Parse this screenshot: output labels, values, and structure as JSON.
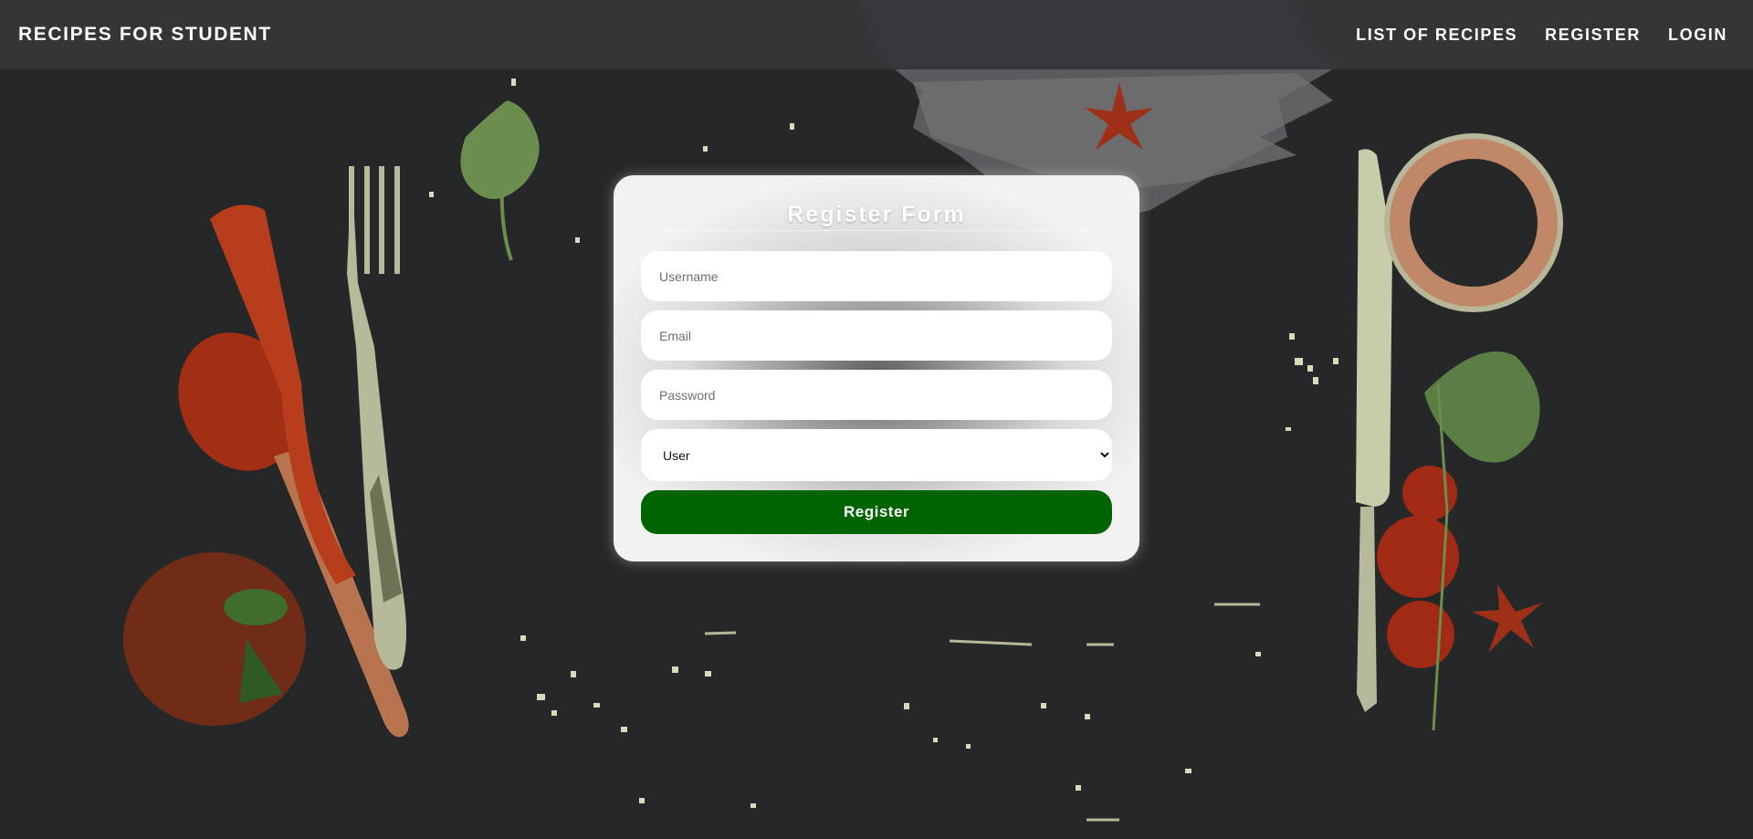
{
  "nav": {
    "brand": "RECIPES FOR STUDENT",
    "links": [
      "LIST OF RECIPES",
      "REGISTER",
      "LOGIN"
    ]
  },
  "form": {
    "title": "Register Form",
    "username_placeholder": "Username",
    "email_placeholder": "Email",
    "password_placeholder": "Password",
    "role_selected": "User",
    "submit_label": "Register"
  },
  "colors": {
    "background": "#262728",
    "navbar": "#363538",
    "button": "#006400"
  }
}
